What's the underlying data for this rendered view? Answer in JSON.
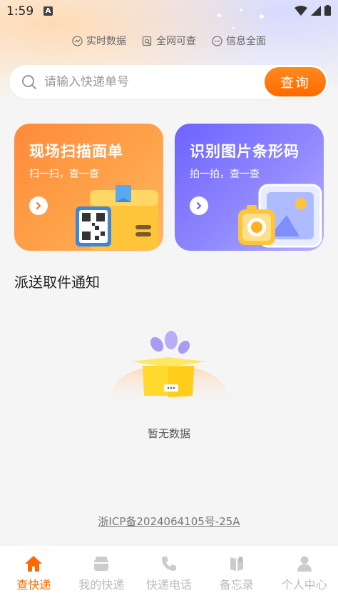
{
  "status_bar": {
    "time": "1:59",
    "notif_letter": "A"
  },
  "features": [
    {
      "icon": "trend-icon",
      "label": "实时数据"
    },
    {
      "icon": "search-doc-icon",
      "label": "全网可查"
    },
    {
      "icon": "chat-icon",
      "label": "信息全面"
    }
  ],
  "search": {
    "placeholder": "请输入快递单号",
    "value": "",
    "button_label": "查询"
  },
  "cards": [
    {
      "title": "现场扫描面单",
      "subtitle": "扫一扫，查一查"
    },
    {
      "title": "识别图片条形码",
      "subtitle": "拍一拍，查一查"
    }
  ],
  "section": {
    "title": "派送取件通知",
    "empty_text": "暂无数据"
  },
  "footer": {
    "icp": "浙ICP备2024064105号-25A"
  },
  "tabs": [
    {
      "label": "查快递",
      "icon": "home-icon",
      "active": true
    },
    {
      "label": "我的快递",
      "icon": "package-icon",
      "active": false
    },
    {
      "label": "快递电话",
      "icon": "phone-icon",
      "active": false
    },
    {
      "label": "备忘录",
      "icon": "book-icon",
      "active": false
    },
    {
      "label": "个人中心",
      "icon": "person-icon",
      "active": false
    }
  ],
  "colors": {
    "accent": "#ff6a00",
    "scan_card": "#ff8a3a",
    "image_card": "#6e62ff",
    "inactive_tab": "#bbbbbb"
  }
}
